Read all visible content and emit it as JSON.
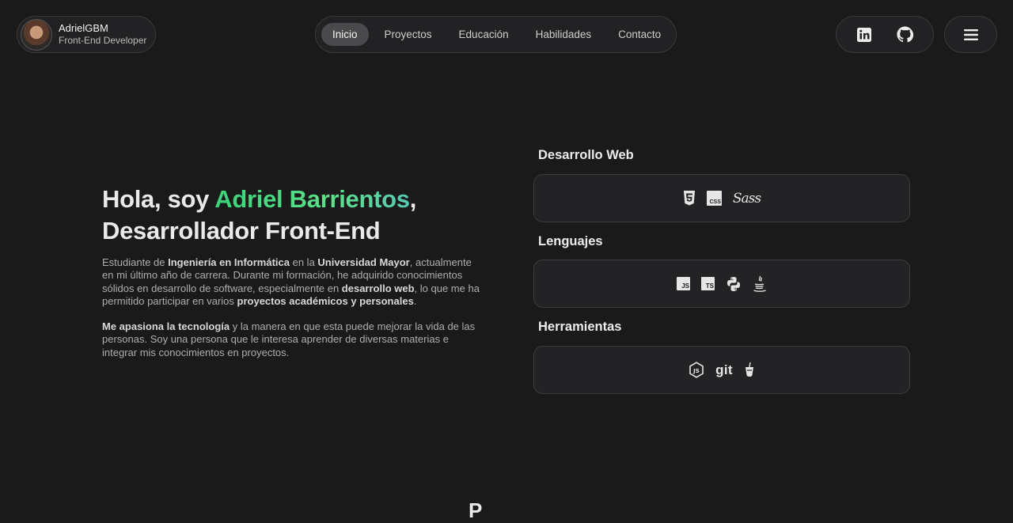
{
  "profile": {
    "name": "AdrielGBM",
    "role": "Front-End Developer"
  },
  "nav": {
    "items": [
      {
        "label": "Inicio",
        "active": true
      },
      {
        "label": "Proyectos",
        "active": false
      },
      {
        "label": "Educación",
        "active": false
      },
      {
        "label": "Habilidades",
        "active": false
      },
      {
        "label": "Contacto",
        "active": false
      }
    ]
  },
  "social": {
    "icons": [
      "linkedin-icon",
      "github-icon"
    ]
  },
  "menu": {
    "icon": "hamburger-menu-icon"
  },
  "hero": {
    "greeting": "Hola, soy ",
    "name": "Adriel Barrientos",
    "comma": ",",
    "role": "Desarrollador Front-End",
    "accent_gradient": [
      "#3bd27a",
      "#58c9b3"
    ]
  },
  "bio": {
    "p1": [
      {
        "t": "Estudiante de ",
        "b": false
      },
      {
        "t": "Ingeniería en Informática",
        "b": true
      },
      {
        "t": " en la ",
        "b": false
      },
      {
        "t": "Universidad Mayor",
        "b": true
      },
      {
        "t": ", actualmente en mi último año de carrera. Durante mi formación, he adquirido conocimientos sólidos en desarrollo de software, especialmente en ",
        "b": false
      },
      {
        "t": "desarrollo web",
        "b": true
      },
      {
        "t": ", lo que me ha permitido participar en varios ",
        "b": false
      },
      {
        "t": "proyectos académicos y personales",
        "b": true
      },
      {
        "t": ".",
        "b": false
      }
    ],
    "p2": [
      {
        "t": "Me apasiona la tecnología",
        "b": true
      },
      {
        "t": " y la manera en que esta puede mejorar la vida de las personas. Soy una persona que le interesa aprender de diversas materias e integrar mis conocimientos en proyectos.",
        "b": false
      }
    ]
  },
  "skills": {
    "web": {
      "title": "Desarrollo Web",
      "icons": [
        "html5-icon",
        "css-icon",
        "sass-icon"
      ],
      "labels": {
        "css": "CSS",
        "sass": "Sass"
      }
    },
    "langs": {
      "title": "Lenguajes",
      "icons": [
        "javascript-icon",
        "typescript-icon",
        "python-icon",
        "java-icon"
      ],
      "labels": {
        "js": "JS",
        "ts": "TS"
      }
    },
    "tools": {
      "title": "Herramientas",
      "icons": [
        "nodejs-icon",
        "git-icon",
        "gulp-icon"
      ],
      "labels": {
        "git": "git"
      }
    }
  },
  "next_section_peek": "P"
}
